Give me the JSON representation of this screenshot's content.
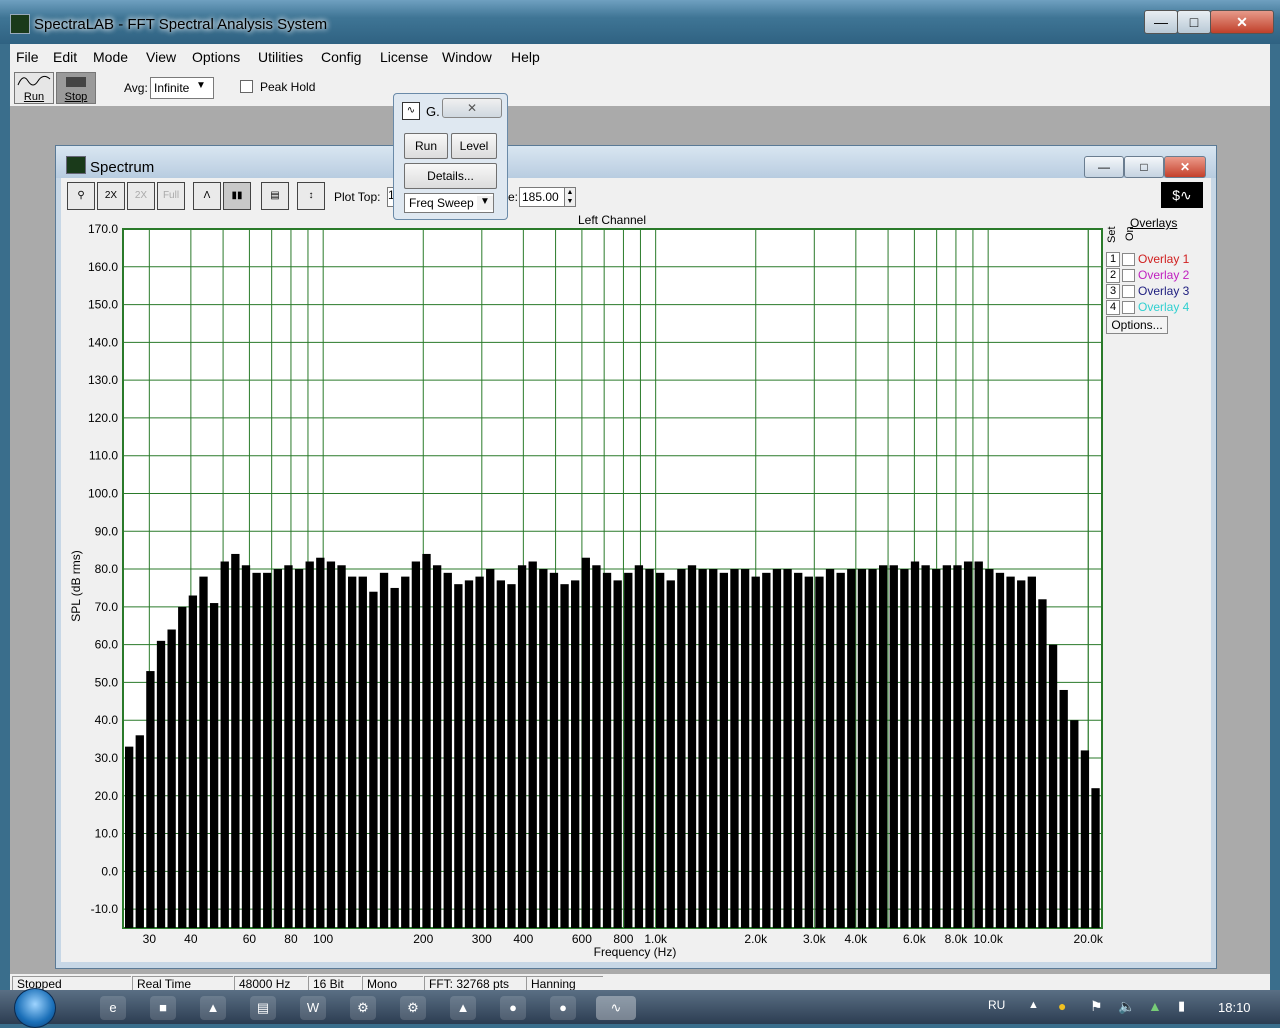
{
  "app": {
    "title": "SpectraLAB - FFT Spectral Analysis System"
  },
  "menu": [
    "File",
    "Edit",
    "Mode",
    "View",
    "Options",
    "Utilities",
    "Config",
    "License",
    "Window",
    "Help"
  ],
  "toolbar": {
    "run_label": "Run",
    "stop_label": "Stop",
    "avg_label": "Avg:",
    "avg_value": "Infinite",
    "peak_hold_label": "Peak Hold"
  },
  "spectrum_window": {
    "title": "Spectrum",
    "plot_top_label": "Plot Top:",
    "plot_top_value": "1",
    "range_label_suffix": "e:",
    "range_value": "185.00",
    "channel_label": "Left Channel"
  },
  "graph_dialog": {
    "title": "G.",
    "run_label": "Run",
    "level_label": "Level",
    "details_label": "Details...",
    "mode_value": "Freq Sweep"
  },
  "overlays": {
    "title": "Overlays",
    "set_label": "Set",
    "on_label": "On",
    "items": [
      {
        "num": "1",
        "label": "Overlay 1",
        "color": "#d02020"
      },
      {
        "num": "2",
        "label": "Overlay 2",
        "color": "#c020c0"
      },
      {
        "num": "3",
        "label": "Overlay 3",
        "color": "#202080"
      },
      {
        "num": "4",
        "label": "Overlay 4",
        "color": "#30d0d0"
      }
    ],
    "options_label": "Options..."
  },
  "statusbar": [
    "Stopped",
    "Real Time",
    "48000 Hz",
    "16 Bit",
    "Mono",
    "FFT: 32768 pts",
    "Hanning"
  ],
  "taskbar": {
    "lang": "RU",
    "clock": "18:10"
  },
  "chart_data": {
    "type": "bar",
    "title": "Left Channel",
    "xlabel": "Frequency (Hz)",
    "ylabel": "SPL (dB rms)",
    "xscale": "log",
    "xlim": [
      25,
      22000
    ],
    "ylim": [
      -15,
      170
    ],
    "yticks": [
      170,
      160,
      150,
      140,
      130,
      120,
      110,
      100,
      90,
      80,
      70,
      60,
      50,
      40,
      30,
      20,
      10,
      0,
      -10
    ],
    "ytick_labels": [
      "170.0",
      "160.0",
      "150.0",
      "140.0",
      "130.0",
      "120.0",
      "110.0",
      "100.0",
      "90.0",
      "80.0",
      "70.0",
      "60.0",
      "50.0",
      "40.0",
      "30.0",
      "20.0",
      "10.0",
      "0.0",
      "-10.0"
    ],
    "xticks": [
      30,
      40,
      60,
      80,
      100,
      200,
      300,
      400,
      600,
      800,
      1000,
      2000,
      3000,
      4000,
      6000,
      8000,
      10000,
      20000
    ],
    "xtick_labels": [
      "30",
      "40",
      "60",
      "80",
      "100",
      "200",
      "300",
      "400",
      "600",
      "800",
      "1.0k",
      "2.0k",
      "3.0k",
      "4.0k",
      "6.0k",
      "8.0k",
      "10.0k",
      "20.0k"
    ],
    "grid": true,
    "grid_color": "#2a7a2a",
    "bar_color": "#000000",
    "values": [
      33,
      36,
      53,
      61,
      64,
      70,
      73,
      78,
      71,
      82,
      84,
      81,
      79,
      79,
      80,
      81,
      80,
      82,
      83,
      82,
      81,
      78,
      78,
      74,
      79,
      75,
      78,
      82,
      84,
      81,
      79,
      76,
      77,
      78,
      80,
      77,
      76,
      81,
      82,
      80,
      79,
      76,
      77,
      83,
      81,
      79,
      77,
      79,
      81,
      80,
      79,
      77,
      80,
      81,
      80,
      80,
      79,
      80,
      80,
      78,
      79,
      80,
      80,
      79,
      78,
      78,
      80,
      79,
      80,
      80,
      80,
      81,
      81,
      80,
      82,
      81,
      80,
      81,
      81,
      82,
      82,
      80,
      79,
      78,
      77,
      78,
      72,
      60,
      48,
      40,
      32,
      22
    ]
  }
}
